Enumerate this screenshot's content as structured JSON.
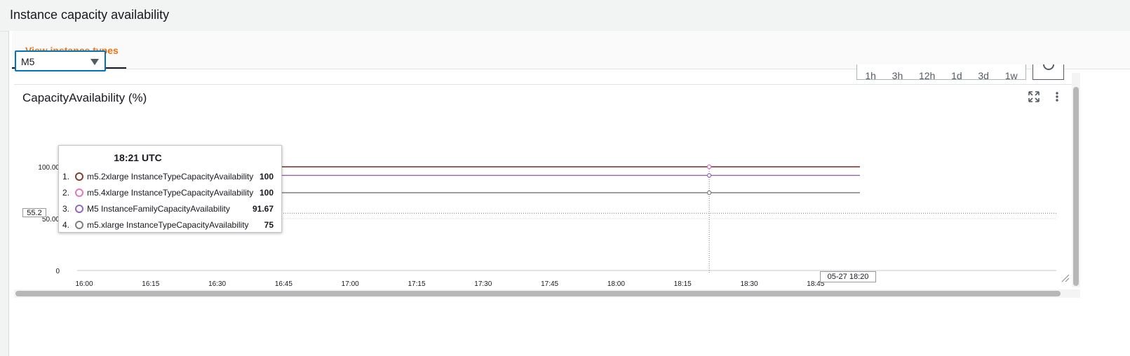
{
  "page": {
    "title": "Instance capacity availability"
  },
  "tabs": [
    {
      "label": "View instance types",
      "active": true
    }
  ],
  "instance_family_select": {
    "value": "M5"
  },
  "time_range_buttons": [
    "1h",
    "3h",
    "12h",
    "1d",
    "3d",
    "1w"
  ],
  "widget": {
    "title": "CapacityAvailability (%)"
  },
  "tooltip": {
    "time": "18:21 UTC",
    "rows": [
      {
        "index": "1.",
        "label": "m5.2xlarge InstanceTypeCapacityAvailability",
        "value": "100",
        "color": "#7d4037"
      },
      {
        "index": "2.",
        "label": "m5.4xlarge InstanceTypeCapacityAvailability",
        "value": "100",
        "color": "#e377c2"
      },
      {
        "index": "3.",
        "label": "M5 InstanceFamilyCapacityAvailability",
        "value": "91.67",
        "color": "#9467bd"
      },
      {
        "index": "4.",
        "label": "m5.xlarge InstanceTypeCapacityAvailability",
        "value": "75",
        "color": "#7f7f7f"
      }
    ]
  },
  "hover": {
    "y_value": "55.2",
    "x_value": "05-27 18:20"
  },
  "chart_data": {
    "type": "line",
    "x": [
      "16:00",
      "16:15",
      "16:30",
      "16:45",
      "17:00",
      "17:15",
      "17:30",
      "17:45",
      "18:00",
      "18:15",
      "18:30",
      "18:45"
    ],
    "x_range": [
      "16:00",
      "18:55"
    ],
    "y_ticks": [
      "0",
      "50.00",
      "100.00"
    ],
    "ylim": [
      0,
      100
    ],
    "series": [
      {
        "name": "m5.2xlarge InstanceTypeCapacityAvailability",
        "color": "#7d4037",
        "start": "16:00",
        "end": "18:55",
        "value": 100
      },
      {
        "name": "m5.4xlarge InstanceTypeCapacityAvailability",
        "color": "#e377c2",
        "start": "16:00",
        "end": "18:55",
        "value": 100
      },
      {
        "name": "M5 InstanceFamilyCapacityAvailability",
        "color": "#9467bd",
        "start": "16:00",
        "end": "18:55",
        "value": 91.67
      },
      {
        "name": "m5.xlarge InstanceTypeCapacityAvailability",
        "color": "#7f7f7f",
        "start": "16:00",
        "end": "18:55",
        "value": 75
      }
    ],
    "grid": true,
    "hover_x": "18:21"
  }
}
